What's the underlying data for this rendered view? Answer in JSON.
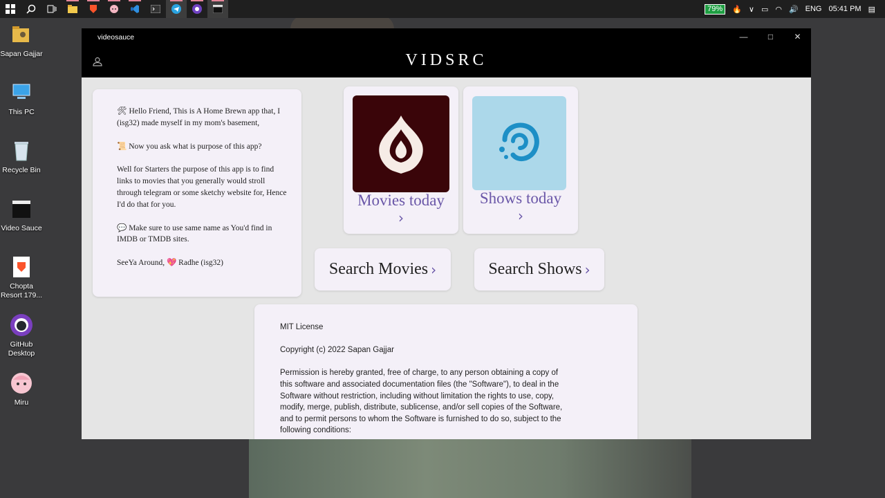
{
  "taskbar": {
    "battery": "79%",
    "language": "ENG",
    "time": "05:41 PM",
    "icons": [
      "windows-start-icon",
      "search-icon",
      "task-view-icon",
      "file-explorer-icon",
      "brave-icon",
      "miru-icon",
      "vscode-icon",
      "terminal-icon",
      "telegram-icon",
      "github-icon",
      "video-sauce-icon"
    ]
  },
  "desktop": {
    "items": [
      {
        "label": "Sapan Gajjar",
        "icon": "user-folder-icon"
      },
      {
        "label": "This PC",
        "icon": "computer-icon"
      },
      {
        "label": "Recycle Bin",
        "icon": "recycle-bin-icon"
      },
      {
        "label": "Video Sauce",
        "icon": "clapperboard-icon"
      },
      {
        "label": "Chopta Resort 179...",
        "icon": "brave-file-icon"
      },
      {
        "label": "GitHub Desktop",
        "icon": "github-icon"
      },
      {
        "label": "Miru",
        "icon": "miru-icon"
      }
    ]
  },
  "window": {
    "title": "videosauce",
    "brand": "VIDSRC"
  },
  "intro": {
    "p1": "🛠 Hello Friend, This is A Home Brewn app that, I (isg32) made myself in my mom's basement,",
    "p2": "📜 Now you ask what is purpose of this app?",
    "p3": "Well for Starters the purpose of this app is to find links to movies that you generally would stroll through telegram or some sketchy website for, Hence I'd do that for you.",
    "p4": "💬 Make sure to use same name as You'd find in IMDB or TMDB sites.",
    "p5": "SeeYa Around, 💖 Radhe (isg32)"
  },
  "tiles": {
    "movies": {
      "label": "Movies today",
      "chevron": "›",
      "bg": "#3a0509"
    },
    "shows": {
      "label": "Shows today",
      "chevron": "›",
      "bg": "#acd8ea"
    }
  },
  "search": {
    "movies": "Search Movies",
    "shows": "Search Shows",
    "chevron": "›"
  },
  "license": {
    "heading": "MIT License",
    "copyright": "Copyright (c) 2022 Sapan Gajjar",
    "body": "Permission is hereby granted, free of charge, to any person obtaining a copy of this software and associated documentation files (the \"Software\"), to deal in the Software without restriction, including without limitation the rights to use, copy, modify, merge, publish, distribute, sublicense, and/or sell copies of the Software, and to permit persons to whom the Software is furnished to do so, subject to the following conditions:"
  },
  "colors": {
    "accent": "#6a57a8",
    "card": "#f4f0f8",
    "titlebar": "#000000"
  }
}
